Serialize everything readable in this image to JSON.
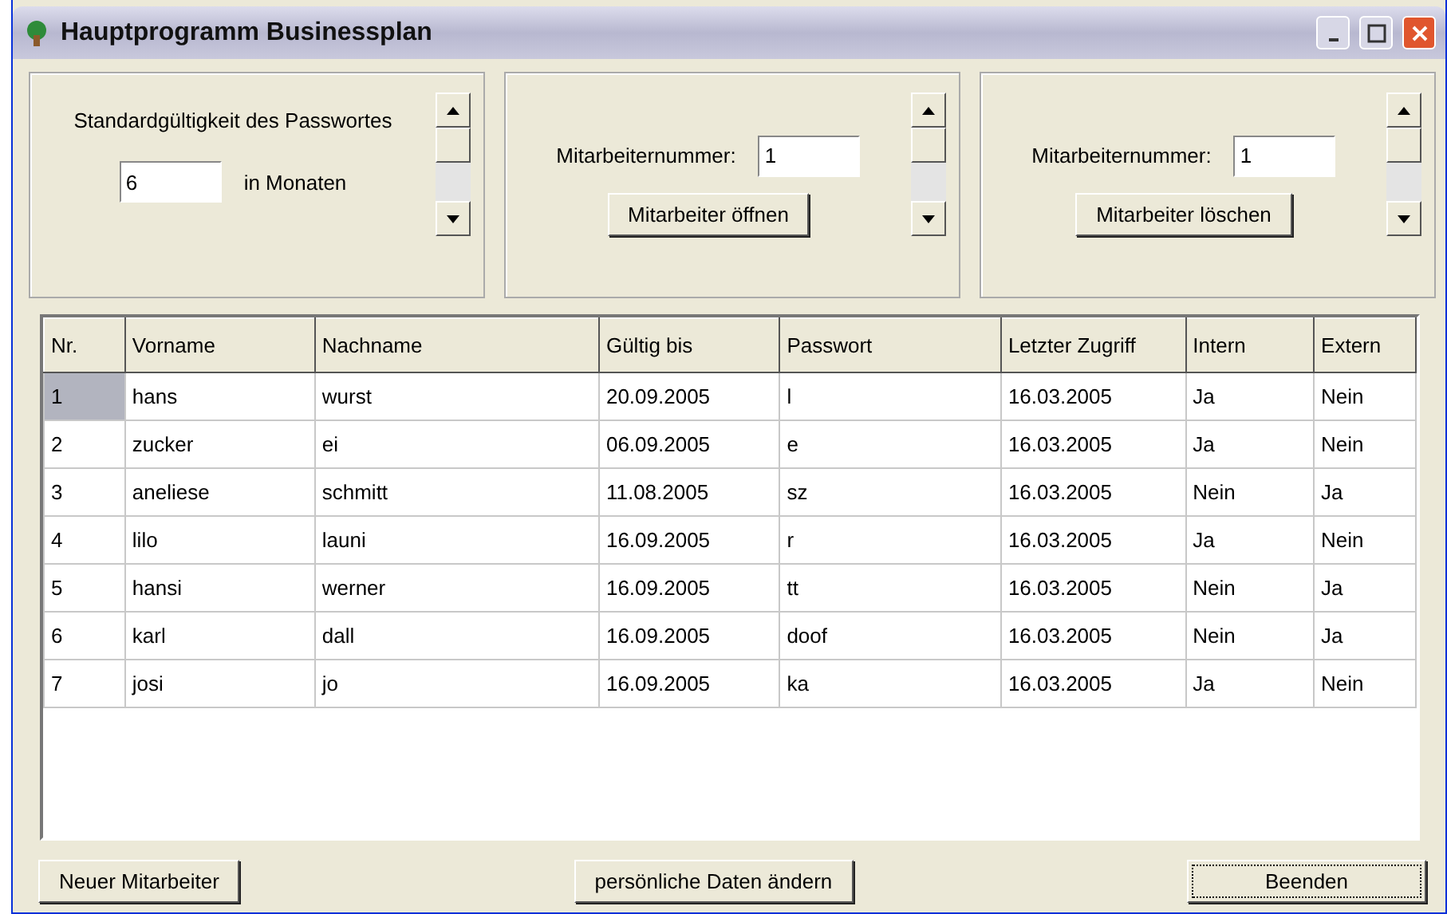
{
  "window": {
    "title": "Hauptprogramm Businessplan"
  },
  "panels": [
    {
      "kind": "validity",
      "label": "Standardgültigkeit des Passwortes",
      "value": "6",
      "unit": "in Monaten"
    },
    {
      "kind": "action",
      "label": "Mitarbeiternummer:",
      "value": "1",
      "button": "Mitarbeiter öffnen"
    },
    {
      "kind": "action",
      "label": "Mitarbeiternummer:",
      "value": "1",
      "button": "Mitarbeiter löschen"
    }
  ],
  "table": {
    "columns": [
      "Nr.",
      "Vorname",
      "Nachname",
      "Gültig bis",
      "Passwort",
      "Letzter Zugriff",
      "Intern",
      "Extern"
    ],
    "rows": [
      {
        "selected": true,
        "cells": [
          "1",
          "hans",
          "wurst",
          "20.09.2005",
          "l",
          "16.03.2005",
          "Ja",
          "Nein"
        ]
      },
      {
        "selected": false,
        "cells": [
          "2",
          "zucker",
          "ei",
          "06.09.2005",
          "e",
          "16.03.2005",
          "Ja",
          "Nein"
        ]
      },
      {
        "selected": false,
        "cells": [
          "3",
          "aneliese",
          "schmitt",
          "11.08.2005",
          "sz",
          "16.03.2005",
          "Nein",
          "Ja"
        ]
      },
      {
        "selected": false,
        "cells": [
          "4",
          "lilo",
          "launi",
          "16.09.2005",
          "r",
          "16.03.2005",
          "Ja",
          "Nein"
        ]
      },
      {
        "selected": false,
        "cells": [
          "5",
          "hansi",
          "werner",
          "16.09.2005",
          "tt",
          "16.03.2005",
          "Nein",
          "Ja"
        ]
      },
      {
        "selected": false,
        "cells": [
          "6",
          "karl",
          "dall",
          "16.09.2005",
          "doof",
          "16.03.2005",
          "Nein",
          "Ja"
        ]
      },
      {
        "selected": false,
        "cells": [
          "7",
          "josi",
          "jo",
          "16.09.2005",
          "ka",
          "16.03.2005",
          "Ja",
          "Nein"
        ]
      }
    ]
  },
  "buttons": [
    {
      "label": "Neuer Mitarbeiter",
      "focused": false
    },
    {
      "label": "persönliche Daten ändern",
      "focused": false
    },
    {
      "label": "Beenden",
      "focused": true
    }
  ]
}
